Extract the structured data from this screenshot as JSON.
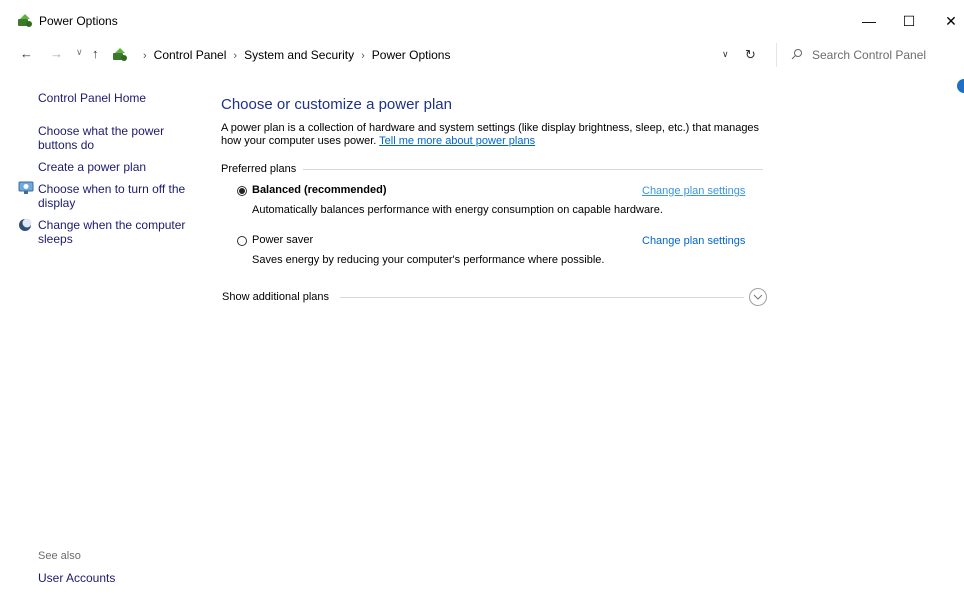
{
  "window": {
    "title": "Power Options",
    "minimize_glyph": "—",
    "maximize_glyph": "☐",
    "close_glyph": "✕"
  },
  "nav": {
    "back_glyph": "←",
    "forward_glyph": "→",
    "recent_glyph": "∨",
    "up_glyph": "↑",
    "breadcrumb": [
      "Control Panel",
      "System and Security",
      "Power Options"
    ],
    "separator": "›",
    "dropdown_glyph": "∨",
    "refresh_glyph": "↻",
    "search_placeholder": "Search Control Panel"
  },
  "sidebar": {
    "home": "Control Panel Home",
    "items": [
      "Choose what the power buttons do",
      "Create a power plan",
      "Choose when to turn off the display",
      "Change when the computer sleeps"
    ],
    "see_also_label": "See also",
    "see_also_items": [
      "User Accounts"
    ]
  },
  "main": {
    "title": "Choose or customize a power plan",
    "description": "A power plan is a collection of hardware and system settings (like display brightness, sleep, etc.) that manages how your computer uses power.",
    "more_link": "Tell me more about power plans",
    "preferred_label": "Preferred plans",
    "plans": [
      {
        "name": "Balanced (recommended)",
        "description": "Automatically balances performance with energy consumption on capable hardware.",
        "link": "Change plan settings",
        "selected": true
      },
      {
        "name": "Power saver",
        "description": "Saves energy by reducing your computer's performance where possible.",
        "link": "Change plan settings",
        "selected": false
      }
    ],
    "show_additional": "Show additional plans"
  },
  "colors": {
    "title_blue": "#1e3287",
    "link_blue": "#0066cc",
    "nav_link": "#1b1b6e"
  }
}
